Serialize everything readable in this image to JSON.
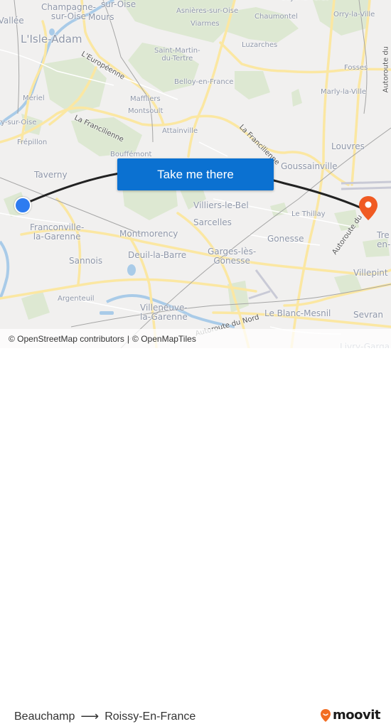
{
  "map": {
    "places": [
      {
        "name": "Champagne-sur-Oise",
        "line1": "Champagne-",
        "line2": "sur-Oise"
      },
      {
        "name": "sur-Oise",
        "line1": "sur-Oise"
      },
      {
        "name": "Mours",
        "line1": "Mours"
      },
      {
        "name": "Asnieres-sur-Oise",
        "line1": "Asnières-sur-Oise"
      },
      {
        "name": "Coye-la-Foret",
        "line1": "Coye-la-Forêt"
      },
      {
        "name": "Chaumontel",
        "line1": "Chaumontel"
      },
      {
        "name": "Orry-la-Ville",
        "line1": "Orry-la-Ville"
      },
      {
        "name": "Vallee",
        "line1": "-Vallée"
      },
      {
        "name": "L'Isle-Adam",
        "line1": "L'Isle-Adam"
      },
      {
        "name": "Viarmes",
        "line1": "Viarmes"
      },
      {
        "name": "Luzarches",
        "line1": "Luzarches"
      },
      {
        "name": "Saint-Martin-du-Tertre",
        "line1": "Saint-Martin-",
        "line2": "du-Tertre"
      },
      {
        "name": "Fosses",
        "line1": "Fosses"
      },
      {
        "name": "Belloy-en-France",
        "line1": "Belloy-en-France"
      },
      {
        "name": "Marly-la-Ville",
        "line1": "Marly-la-Ville"
      },
      {
        "name": "Maffliers",
        "line1": "Maffliers"
      },
      {
        "name": "Meriel",
        "line1": "Mériel"
      },
      {
        "name": "Montsoult",
        "line1": "Montsoult"
      },
      {
        "name": "Mery-sur-Oise",
        "line1": "ry-sur-Oise"
      },
      {
        "name": "Attainville",
        "line1": "Attainville"
      },
      {
        "name": "Frepillon",
        "line1": "Frépillon"
      },
      {
        "name": "Bouffemont",
        "line1": "Bouffémont"
      },
      {
        "name": "Louvres",
        "line1": "Louvres"
      },
      {
        "name": "Taverny",
        "line1": "Taverny"
      },
      {
        "name": "Goussainville",
        "line1": "Goussainville"
      },
      {
        "name": "Villiers-le-Bel",
        "line1": "Villiers-le-Bel"
      },
      {
        "name": "Le Thillay",
        "line1": "Le Thillay"
      },
      {
        "name": "Franconville-la-Garenne",
        "line1": "Franconville-",
        "line2": "la-Garenne"
      },
      {
        "name": "Sarcelles",
        "line1": "Sarcelles"
      },
      {
        "name": "Montmorency",
        "line1": "Montmorency"
      },
      {
        "name": "Gonesse",
        "line1": "Gonesse"
      },
      {
        "name": "Tremblay-en-France",
        "line1": "Tre",
        "line2": "en-"
      },
      {
        "name": "Garges-les-Gonesse",
        "line1": "Garges-lès-",
        "line2": "Gonesse"
      },
      {
        "name": "Deuil-la-Barre",
        "line1": "Deuil-la-Barre"
      },
      {
        "name": "Sannois",
        "line1": "Sannois"
      },
      {
        "name": "Villepinte",
        "line1": "Villepint"
      },
      {
        "name": "Argenteuil",
        "line1": "Argenteuil"
      },
      {
        "name": "Le Blanc-Mesnil",
        "line1": "Le Blanc-Mesnil"
      },
      {
        "name": "Sevran",
        "line1": "Sevran"
      },
      {
        "name": "Villeneuve-la-Garenne",
        "line1": "Villeneuve-",
        "line2": "la-Garenne"
      },
      {
        "name": "Livry-Gargan",
        "line1": "Livry-Garga"
      }
    ],
    "roads": [
      {
        "name": "L'Européenne"
      },
      {
        "name": "La Francilienne"
      },
      {
        "name": "La Francilienne"
      },
      {
        "name": "Autoroute du"
      },
      {
        "name": "Autoroute du Nord"
      },
      {
        "name": "Autoroute du"
      }
    ],
    "cta_label": "Take me there",
    "origin_marker": {
      "label": "Beauchamp",
      "color": "#2e7cf0"
    },
    "destination_marker": {
      "label": "Roissy-En-France",
      "color": "#f05a22"
    },
    "route_color": "#222222",
    "attribution": {
      "osm": "© OpenStreetMap contributors",
      "separator": "|",
      "omt": "© OpenMapTiles"
    }
  },
  "footer": {
    "origin": "Beauchamp",
    "arrow": "⟶",
    "destination": "Roissy-En-France",
    "brand": "moovit",
    "brand_color": "#f26d22"
  }
}
